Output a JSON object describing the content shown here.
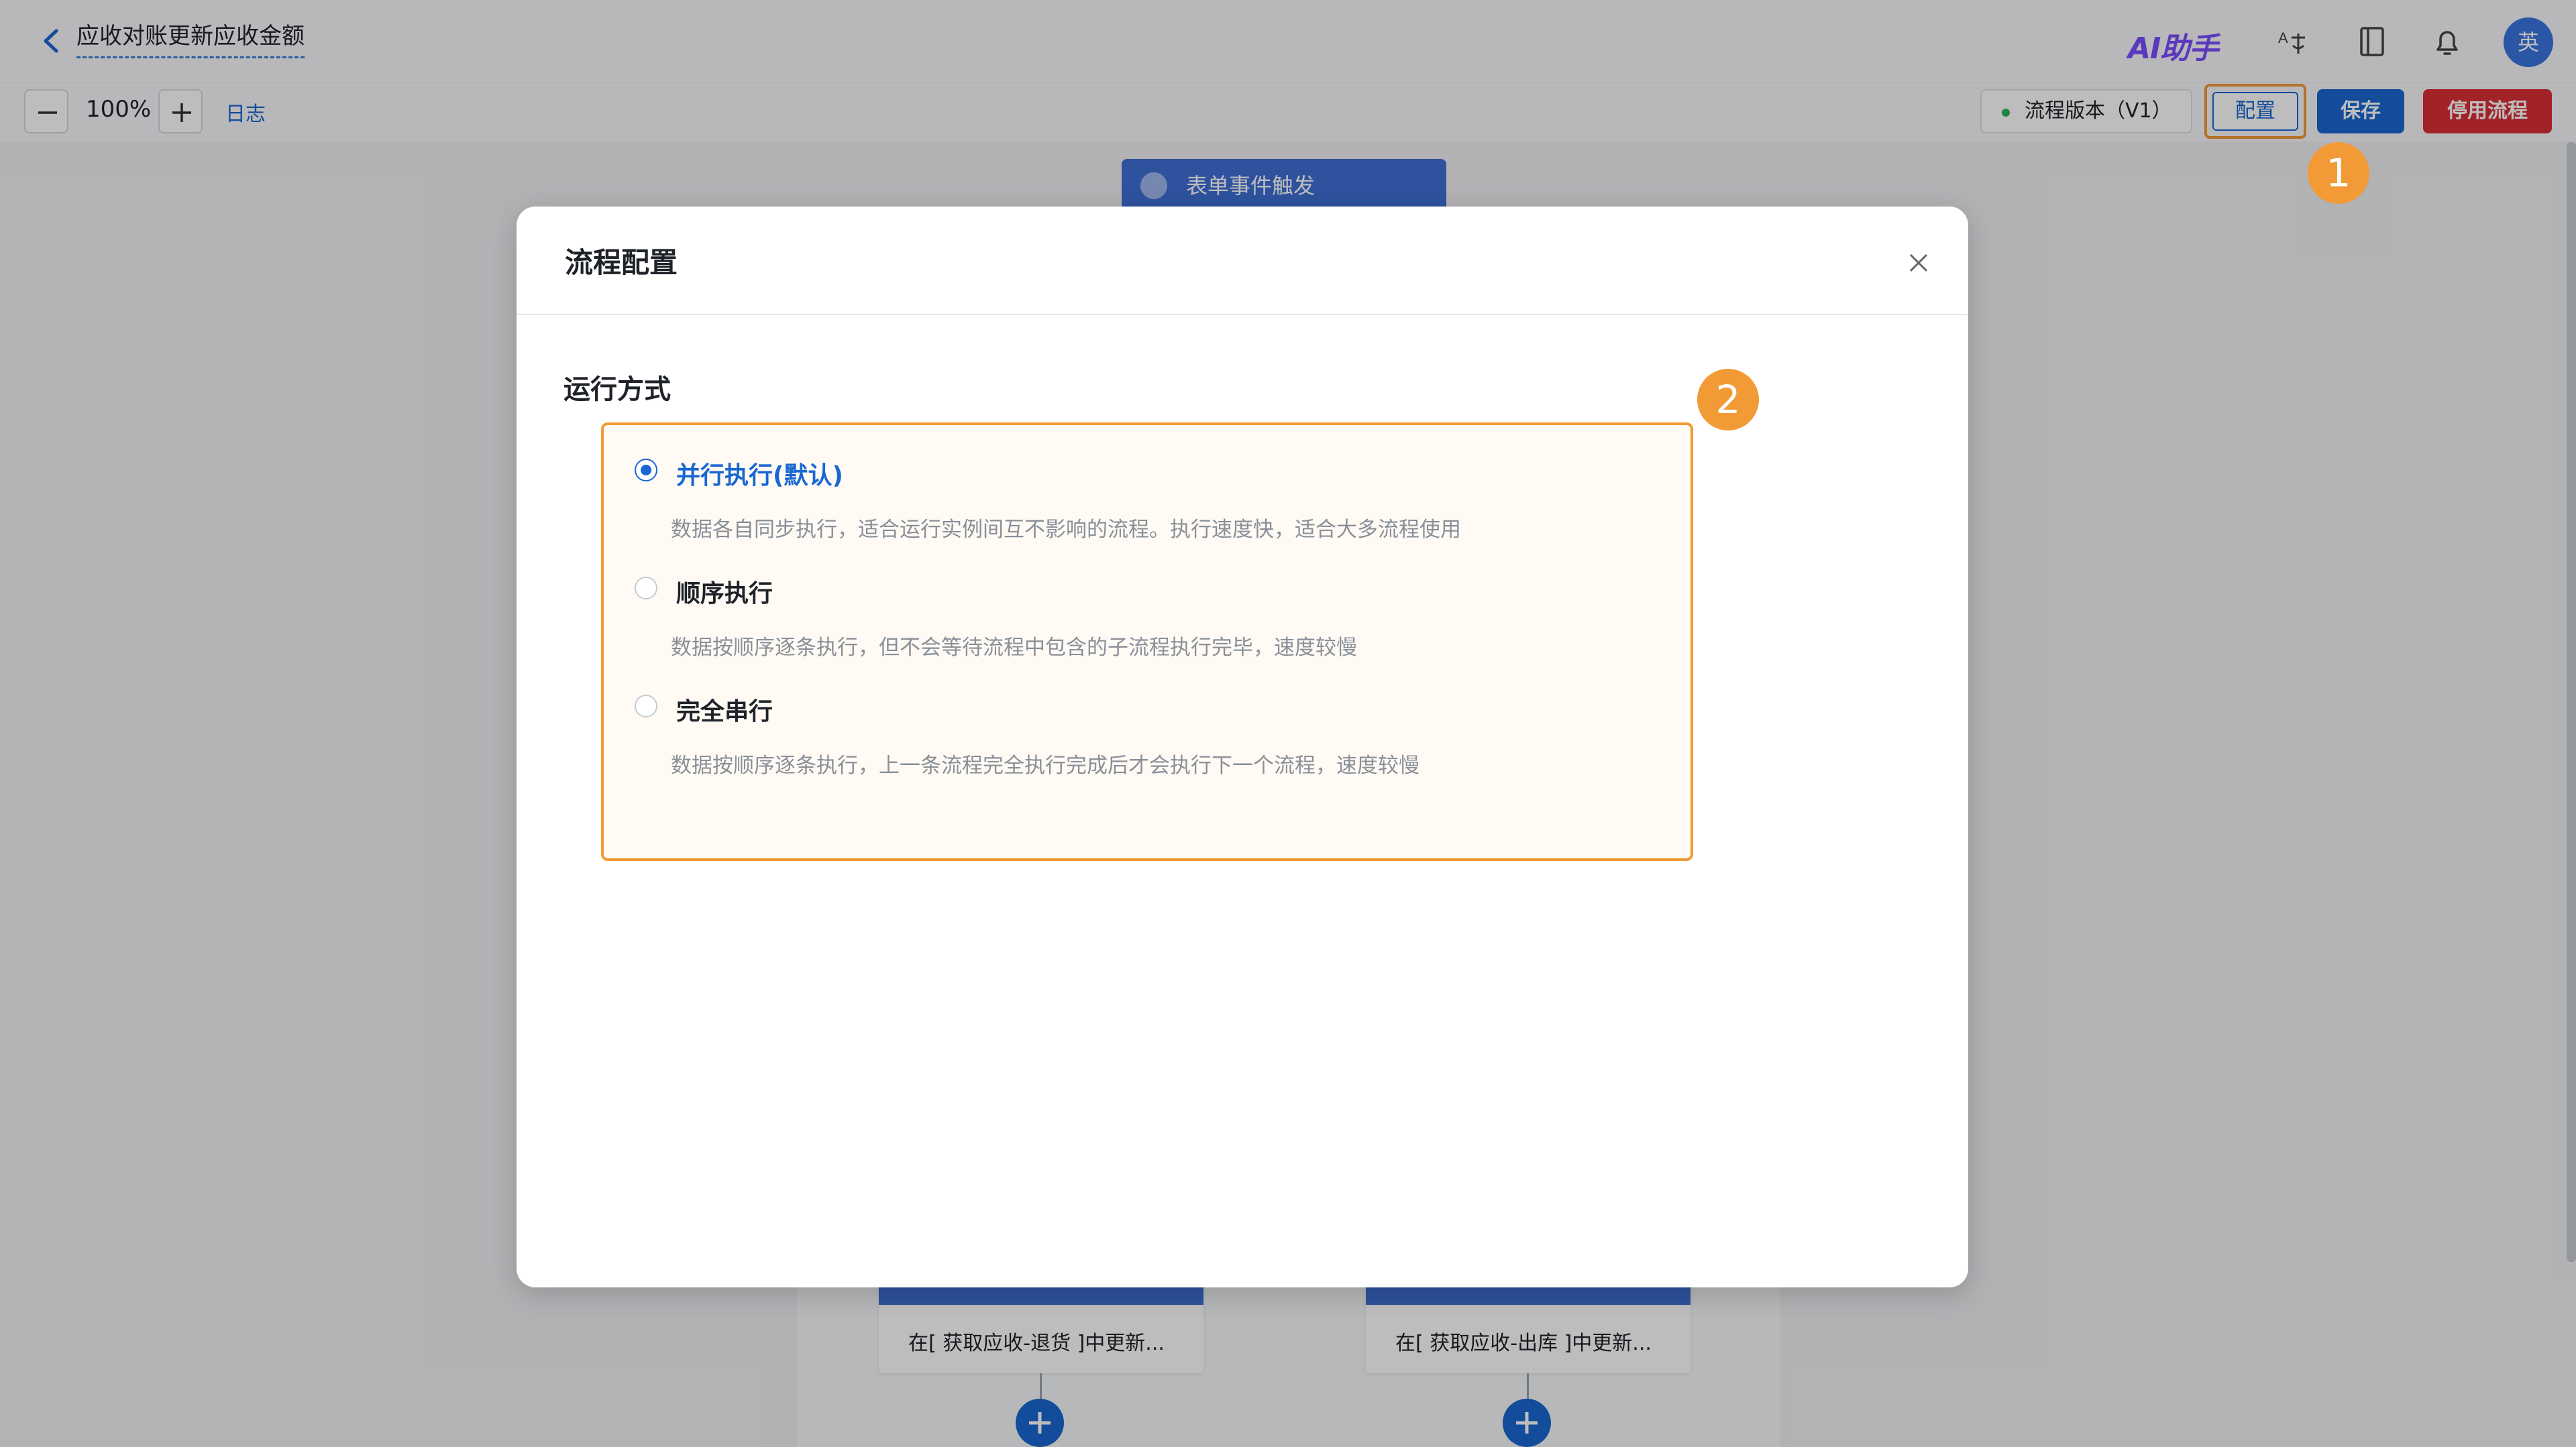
{
  "header": {
    "flow_title": "应收对账更新应收金额",
    "ai_assistant": "AI助手",
    "avatar_text": "英"
  },
  "toolbar": {
    "zoom_level": "100%",
    "log_link": "日志",
    "version_button": "流程版本（V1）",
    "config_button": "配置",
    "save_button": "保存",
    "disable_button": "停用流程"
  },
  "canvas": {
    "trigger_node": "表单事件触发",
    "branch_nodes": [
      {
        "label": "在[ 获取应收-退货 ]中更新..."
      },
      {
        "label": "在[ 获取应收-出库 ]中更新..."
      }
    ]
  },
  "modal": {
    "title": "流程配置",
    "section_label": "运行方式",
    "options": [
      {
        "title": "并行执行(默认)",
        "desc": "数据各自同步执行，适合运行实例间互不影响的流程。执行速度快，适合大多流程使用",
        "selected": true
      },
      {
        "title": "顺序执行",
        "desc": "数据按顺序逐条执行，但不会等待流程中包含的子流程执行完毕，速度较慢",
        "selected": false
      },
      {
        "title": "完全串行",
        "desc": "数据按顺序逐条执行，上一条流程完全执行完成后才会执行下一个流程，速度较慢",
        "selected": false
      }
    ]
  },
  "callouts": [
    "1",
    "2"
  ],
  "colors": {
    "primary": "#1967d2",
    "danger": "#d93036",
    "highlight": "#f29a36",
    "node": "#3f6fd6"
  }
}
